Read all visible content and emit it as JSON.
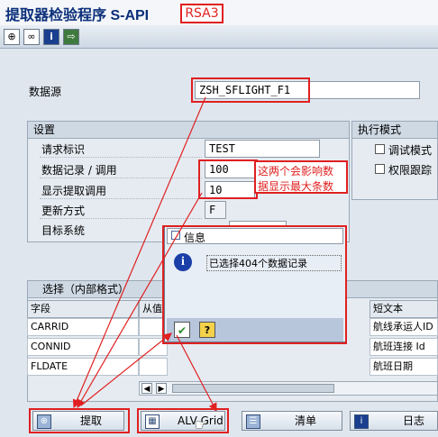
{
  "window": {
    "title": "提取器检验程序 S-API",
    "tag": "RSA3"
  },
  "datasource": {
    "label": "数据源",
    "value": "ZSH_SFLIGHT_F1"
  },
  "settings": {
    "header": "设置",
    "rows": [
      {
        "label": "请求标识",
        "value": "TEST"
      },
      {
        "label": "数据记录 / 调用",
        "value": "100"
      },
      {
        "label": "显示提取调用",
        "value": "10"
      },
      {
        "label": "更新方式",
        "value": "F"
      },
      {
        "label": "目标系统",
        "value": ""
      }
    ],
    "annotation": [
      "这两个会影响数",
      "据显示最大条数"
    ]
  },
  "exec_mode": {
    "header": "执行模式",
    "options": [
      {
        "label": "调试模式",
        "checked": false
      },
      {
        "label": "权限跟踪",
        "checked": false
      }
    ]
  },
  "selection": {
    "header": "选择（内部格式）",
    "columns": {
      "field": "字段",
      "from": "从值",
      "short_text": "短文本"
    },
    "rows": [
      {
        "field": "CARRID",
        "short_text": "航线承运人ID"
      },
      {
        "field": "CONNID",
        "short_text": "航班连接 Id"
      },
      {
        "field": "FLDATE",
        "short_text": "航班日期"
      }
    ]
  },
  "dialog": {
    "title": "信息",
    "message": "已选择404个数据记录"
  },
  "buttons": {
    "extract": "提取",
    "alv": "ALV Grid",
    "list": "清单",
    "log": "日志"
  },
  "colors": {
    "annotation": "#e02020",
    "title": "#0b2f7a"
  }
}
